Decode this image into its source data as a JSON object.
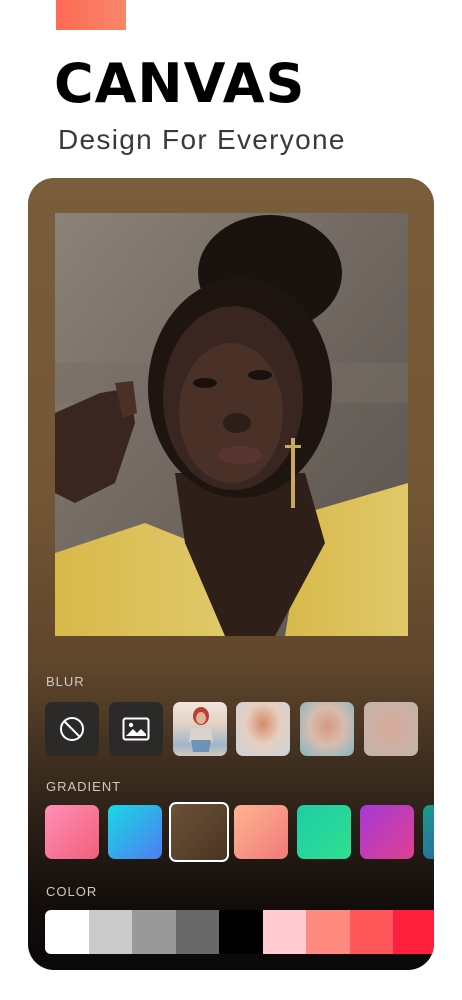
{
  "header": {
    "title": "CANVAS",
    "subtitle": "Design For Everyone",
    "accent_color": "#ff6a55"
  },
  "editor": {
    "photo": {
      "description_icon": "portrait-photo"
    },
    "blur": {
      "label": "BLUR",
      "options": [
        {
          "name": "none",
          "icon": "no-blur-icon"
        },
        {
          "name": "image",
          "icon": "image-icon"
        },
        {
          "name": "blur-level-1"
        },
        {
          "name": "blur-level-2"
        },
        {
          "name": "blur-level-3"
        },
        {
          "name": "blur-level-4"
        }
      ]
    },
    "gradient": {
      "label": "GRADIENT",
      "swatches": [
        {
          "from": "#ff8fb8",
          "to": "#f25f7a"
        },
        {
          "from": "#18d8e6",
          "to": "#4f7df0"
        },
        {
          "from": "#6b5238",
          "to": "#4a3523",
          "selected": true
        },
        {
          "from": "#ffb490",
          "to": "#f07a7a"
        },
        {
          "from": "#1fcca8",
          "to": "#2ee08e"
        },
        {
          "from": "#a43ad8",
          "to": "#e0408f"
        },
        {
          "from": "#1a9b8a",
          "to": "#2b6f9e"
        }
      ]
    },
    "color": {
      "label": "COLOR",
      "swatches": [
        "#ffffff",
        "#cbcbcb",
        "#999999",
        "#686868",
        "#000000",
        "#ffccd2",
        "#ff8a80",
        "#ff5659",
        "#ff1f3d"
      ]
    }
  }
}
